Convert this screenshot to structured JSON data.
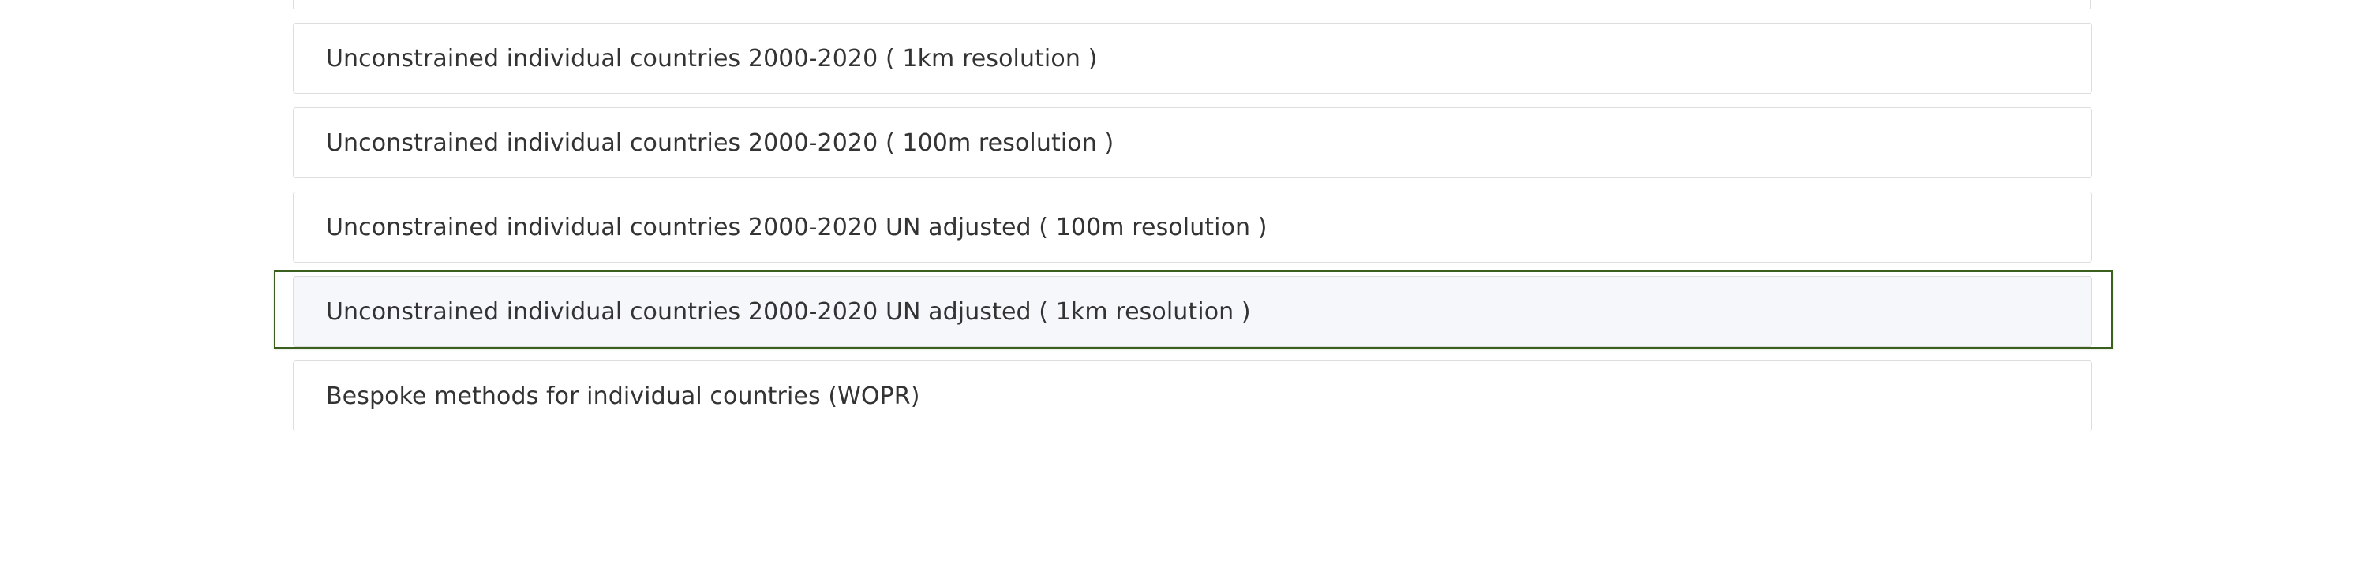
{
  "list": {
    "items": [
      {
        "label": "Unconstrained individual countries 2000-2020 ( 1km resolution )"
      },
      {
        "label": "Unconstrained individual countries 2000-2020 ( 100m resolution )"
      },
      {
        "label": "Unconstrained individual countries 2000-2020 UN adjusted ( 100m resolution )"
      },
      {
        "label": "Unconstrained individual countries 2000-2020 UN adjusted ( 1km resolution )"
      },
      {
        "label": "Bespoke methods for individual countries (WOPR)"
      }
    ],
    "focused_index": 3
  },
  "colors": {
    "border": "#dddddd",
    "focus_ring": "#3a5f1e",
    "active_bg": "#f5f7fa",
    "text": "#333333"
  }
}
